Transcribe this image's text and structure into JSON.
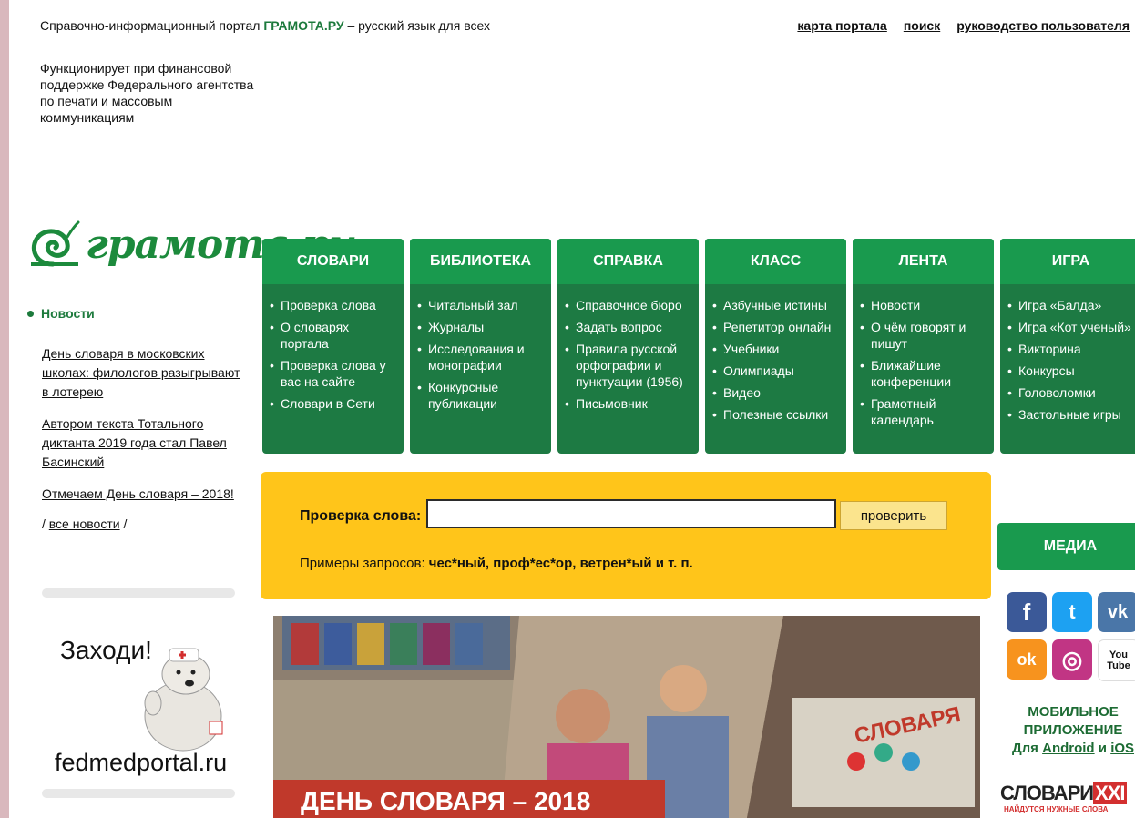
{
  "header": {
    "portal_prefix": "Справочно-информационный портал",
    "portal_brand": "ГРАМОТА.РУ",
    "portal_suffix": "– русский язык для всех",
    "links": [
      "карта портала",
      "поиск",
      "руководство пользователя"
    ],
    "funding": "Функционирует при финансовой поддержке Федерального агентства по печати и массовым коммуникациям"
  },
  "logo": {
    "text": "грамота.ру"
  },
  "news": {
    "heading": "Новости",
    "items": [
      "День словаря в московских школах: филологов разыгрывают в лотерею",
      "Автором текста Тотального диктанта 2019 года стал Павел Басинский",
      "Отмечаем День словаря – 2018!"
    ],
    "all_prefix": "/",
    "all_label": "все новости",
    "all_suffix": "/"
  },
  "ad": {
    "title": "Заходи!",
    "site": "fedmedportal.ru"
  },
  "menus": [
    {
      "title": "СЛОВАРИ",
      "items": [
        "Проверка слова",
        "О словарях портала",
        "Проверка слова у вас на сайте",
        "Словари в Сети"
      ]
    },
    {
      "title": "БИБЛИОТЕКА",
      "items": [
        "Читальный зал",
        "Журналы",
        "Исследования и монографии",
        "Конкурсные публикации"
      ]
    },
    {
      "title": "СПРАВКА",
      "items": [
        "Справочное бюро",
        "Задать вопрос",
        "Правила русской орфографии и пунктуации (1956)",
        "Письмовник"
      ]
    },
    {
      "title": "КЛАСС",
      "items": [
        "Азбучные истины",
        "Репетитор онлайн",
        "Учебники",
        "Олимпиады",
        "Видео",
        "Полезные ссылки"
      ]
    },
    {
      "title": "ЛЕНТА",
      "items": [
        "Новости",
        "О чём говорят и пишут",
        "Ближайшие конференции",
        "Грамотный календарь"
      ]
    },
    {
      "title": "ИГРА",
      "items": [
        "Игра «Балда»",
        "Игра «Кот ученый»",
        "Викторина",
        "Конкурсы",
        "Головоломки",
        "Застольные игры"
      ]
    }
  ],
  "check": {
    "label": "Проверка слова:",
    "value": "",
    "button": "проверить",
    "examples_prefix": "Примеры запросов:",
    "examples": "чес*ный, проф*ес*ор, ветрен*ый и т. п."
  },
  "banner": {
    "caption": "ДЕНЬ СЛОВАРЯ – 2018",
    "book_text": "СЛОВАРЯ"
  },
  "right": {
    "media_title": "МЕДИА",
    "social": [
      {
        "icon": "facebook-icon",
        "glyph": "f",
        "color": "#3b5998"
      },
      {
        "icon": "twitter-icon",
        "glyph": "t",
        "color": "#1da1f2"
      },
      {
        "icon": "vk-icon",
        "glyph": "vk",
        "color": "#4a76a8"
      },
      {
        "icon": "odnoklassniki-icon",
        "glyph": "ok",
        "color": "#f7931e"
      },
      {
        "icon": "instagram-icon",
        "glyph": "◎",
        "color": "#c13584"
      },
      {
        "icon": "youtube-icon",
        "glyph": "You Tube",
        "color": "#d52121"
      }
    ],
    "mobile_line1": "МОБИЛЬНОЕ",
    "mobile_line2": "ПРИЛОЖЕНИЕ",
    "mobile_for": "Для",
    "mobile_android": "Android",
    "mobile_and": "и",
    "mobile_ios": "iOS",
    "slovari_main": "СЛОВАРИ",
    "slovari_xxi": "XXI",
    "slovari_tag": "НАЙДУТСЯ НУЖНЫЕ СЛОВА"
  }
}
